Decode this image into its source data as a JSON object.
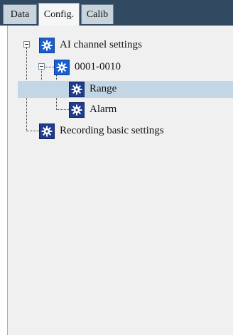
{
  "tabs": [
    {
      "label": "Data",
      "active": false
    },
    {
      "label": "Config.",
      "active": true
    },
    {
      "label": "Calib",
      "active": false
    }
  ],
  "tree": {
    "nodes": [
      {
        "label": "AI channel settings",
        "expanded": true
      },
      {
        "label": "0001-0010",
        "expanded": true
      },
      {
        "label": "Range",
        "selected": true
      },
      {
        "label": "Alarm"
      },
      {
        "label": "Recording basic settings"
      }
    ]
  },
  "colors": {
    "tabbar_bg": "#324a61",
    "selection_bg": "#c3d6e6",
    "icon_blue": "#1a5fd0",
    "icon_dark": "#1e3c8c"
  },
  "icons": {
    "node": "gear-icon",
    "expander": "minus-expander-icon"
  }
}
